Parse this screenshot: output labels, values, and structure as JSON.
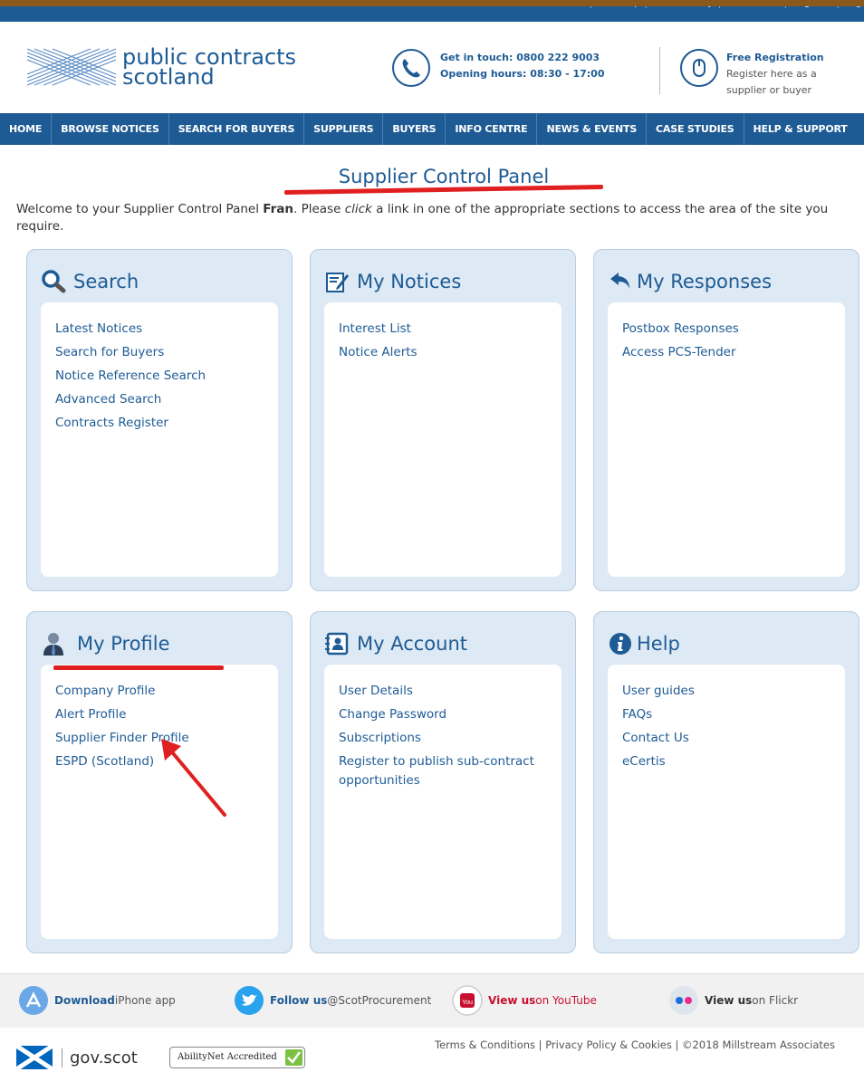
{
  "top_links": [
    "About Us",
    "Site Map",
    "Accessibility",
    "Contact Us",
    "Register",
    "Log o"
  ],
  "brand": {
    "line1": "public contracts",
    "line2": "scotland"
  },
  "contact": {
    "line1": "Get in touch: 0800 222 9003",
    "line2": "Opening hours: 08:30 - 17:00"
  },
  "registration": {
    "title": "Free Registration",
    "line1": "Register here as a",
    "line2": "supplier or buyer"
  },
  "nav": [
    "HOME",
    "BROWSE NOTICES",
    "SEARCH FOR BUYERS",
    "SUPPLIERS",
    "BUYERS",
    "INFO CENTRE",
    "NEWS & EVENTS",
    "CASE STUDIES",
    "HELP & SUPPORT"
  ],
  "page_title": "Supplier Control Panel",
  "welcome": {
    "pre": "Welcome to your Supplier Control Panel ",
    "name": "Fran",
    "mid": ". Please ",
    "click": "click",
    "post": " a link in one of the appropriate sections to access the area of the site you require."
  },
  "panels": [
    {
      "title": "Search",
      "icon": "search-icon",
      "links": [
        "Latest Notices",
        "Search for Buyers",
        "Notice Reference Search",
        "Advanced Search",
        "Contracts Register"
      ]
    },
    {
      "title": "My Notices",
      "icon": "edit-notice-icon",
      "links": [
        "Interest List",
        "Notice Alerts"
      ]
    },
    {
      "title": "My Responses",
      "icon": "reply-arrow-icon",
      "links": [
        "Postbox Responses",
        "Access PCS-Tender"
      ]
    },
    {
      "title": "My Profile",
      "icon": "user-profile-icon",
      "links": [
        "Company Profile",
        "Alert Profile",
        "Supplier Finder Profile",
        "ESPD (Scotland)"
      ]
    },
    {
      "title": "My Account",
      "icon": "contact-card-icon",
      "links": [
        "User Details",
        "Change Password",
        "Subscriptions",
        "Register to publish sub-contract opportunities"
      ]
    },
    {
      "title": "Help",
      "icon": "info-icon",
      "links": [
        "User guides",
        "FAQs",
        "Contact Us",
        "eCertis"
      ]
    }
  ],
  "footer": {
    "iphone": {
      "bold": "Download",
      "rest": " iPhone app"
    },
    "twitter": {
      "bold": "Follow us",
      "rest": " @ScotProcurement"
    },
    "youtube": {
      "bold": "View us",
      "rest": " on YouTube"
    },
    "flickr": {
      "bold": "View us",
      "rest": " on Flickr"
    }
  },
  "gov": "gov.scot",
  "ability": "AbilityNet Accredited",
  "legal": "Terms & Conditions | Privacy Policy & Cookies | ©2018 Millstream Associates",
  "colors": {
    "brand_blue": "#1e5b95",
    "annotation_red": "#e02020",
    "panel_bg": "#dde9f4"
  }
}
